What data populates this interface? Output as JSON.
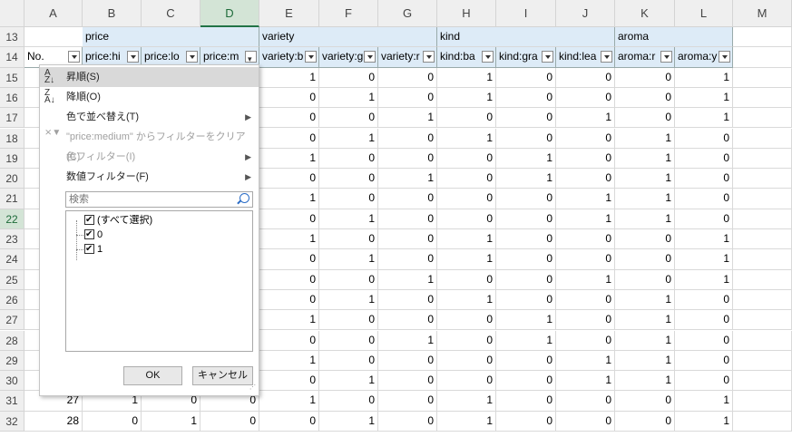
{
  "columns": [
    "A",
    "B",
    "C",
    "D",
    "E",
    "F",
    "G",
    "H",
    "I",
    "J",
    "K",
    "L",
    "M"
  ],
  "row13": {
    "price": "price",
    "variety": "variety",
    "kind": "kind",
    "aroma": "aroma"
  },
  "row14": [
    "No.",
    "price:hi",
    "price:lo",
    "price:m",
    "variety:b",
    "variety:g",
    "variety:r",
    "kind:ba",
    "kind:gra",
    "kind:lea",
    "aroma:r",
    "aroma:y"
  ],
  "rows": [
    {
      "n": "15",
      "v": [
        1,
        0,
        0,
        1,
        0,
        0,
        0,
        1
      ]
    },
    {
      "n": "16",
      "v": [
        0,
        1,
        0,
        1,
        0,
        0,
        0,
        1
      ]
    },
    {
      "n": "17",
      "v": [
        0,
        0,
        1,
        0,
        0,
        1,
        0,
        1
      ]
    },
    {
      "n": "18",
      "v": [
        0,
        1,
        0,
        1,
        0,
        0,
        1,
        0
      ]
    },
    {
      "n": "19",
      "v": [
        1,
        0,
        0,
        0,
        1,
        0,
        1,
        0
      ]
    },
    {
      "n": "20",
      "v": [
        0,
        0,
        1,
        0,
        1,
        0,
        1,
        0
      ]
    },
    {
      "n": "21",
      "v": [
        1,
        0,
        0,
        0,
        0,
        1,
        1,
        0
      ]
    },
    {
      "n": "22",
      "v": [
        0,
        1,
        0,
        0,
        0,
        1,
        1,
        0
      ]
    },
    {
      "n": "23",
      "v": [
        1,
        0,
        0,
        1,
        0,
        0,
        0,
        1
      ]
    },
    {
      "n": "24",
      "v": [
        0,
        1,
        0,
        1,
        0,
        0,
        0,
        1
      ]
    },
    {
      "n": "25",
      "v": [
        0,
        0,
        1,
        0,
        0,
        1,
        0,
        1
      ]
    },
    {
      "n": "26",
      "v": [
        0,
        1,
        0,
        1,
        0,
        0,
        1,
        0
      ]
    },
    {
      "n": "27",
      "v": [
        1,
        0,
        0,
        0,
        1,
        0,
        1,
        0
      ]
    },
    {
      "n": "28",
      "v": [
        0,
        0,
        1,
        0,
        1,
        0,
        1,
        0
      ]
    },
    {
      "n": "29",
      "v": [
        1,
        0,
        0,
        0,
        0,
        1,
        1,
        0
      ]
    },
    {
      "n": "30",
      "v": [
        0,
        1,
        0,
        0,
        0,
        1,
        1,
        0
      ]
    },
    {
      "n": "31",
      "a": "27",
      "b": "1",
      "c": "0",
      "d": "0",
      "v": [
        1,
        0,
        0,
        1,
        0,
        0,
        0,
        1
      ]
    },
    {
      "n": "32",
      "a": "28",
      "b": "0",
      "c": "1",
      "d": "0",
      "v": [
        0,
        1,
        0,
        1,
        0,
        0,
        0,
        1
      ]
    }
  ],
  "menu": {
    "sort_asc": "昇順(S)",
    "sort_desc": "降順(O)",
    "sort_color": "色で並べ替え(T)",
    "clear_filter": "\"price:medium\" からフィルターをクリア(C)",
    "color_filter": "色フィルター(I)",
    "number_filter": "数値フィルター(F)",
    "search_placeholder": "検索",
    "items": [
      "(すべて選択)",
      "0",
      "1"
    ],
    "ok": "OK",
    "cancel": "キャンセル"
  }
}
